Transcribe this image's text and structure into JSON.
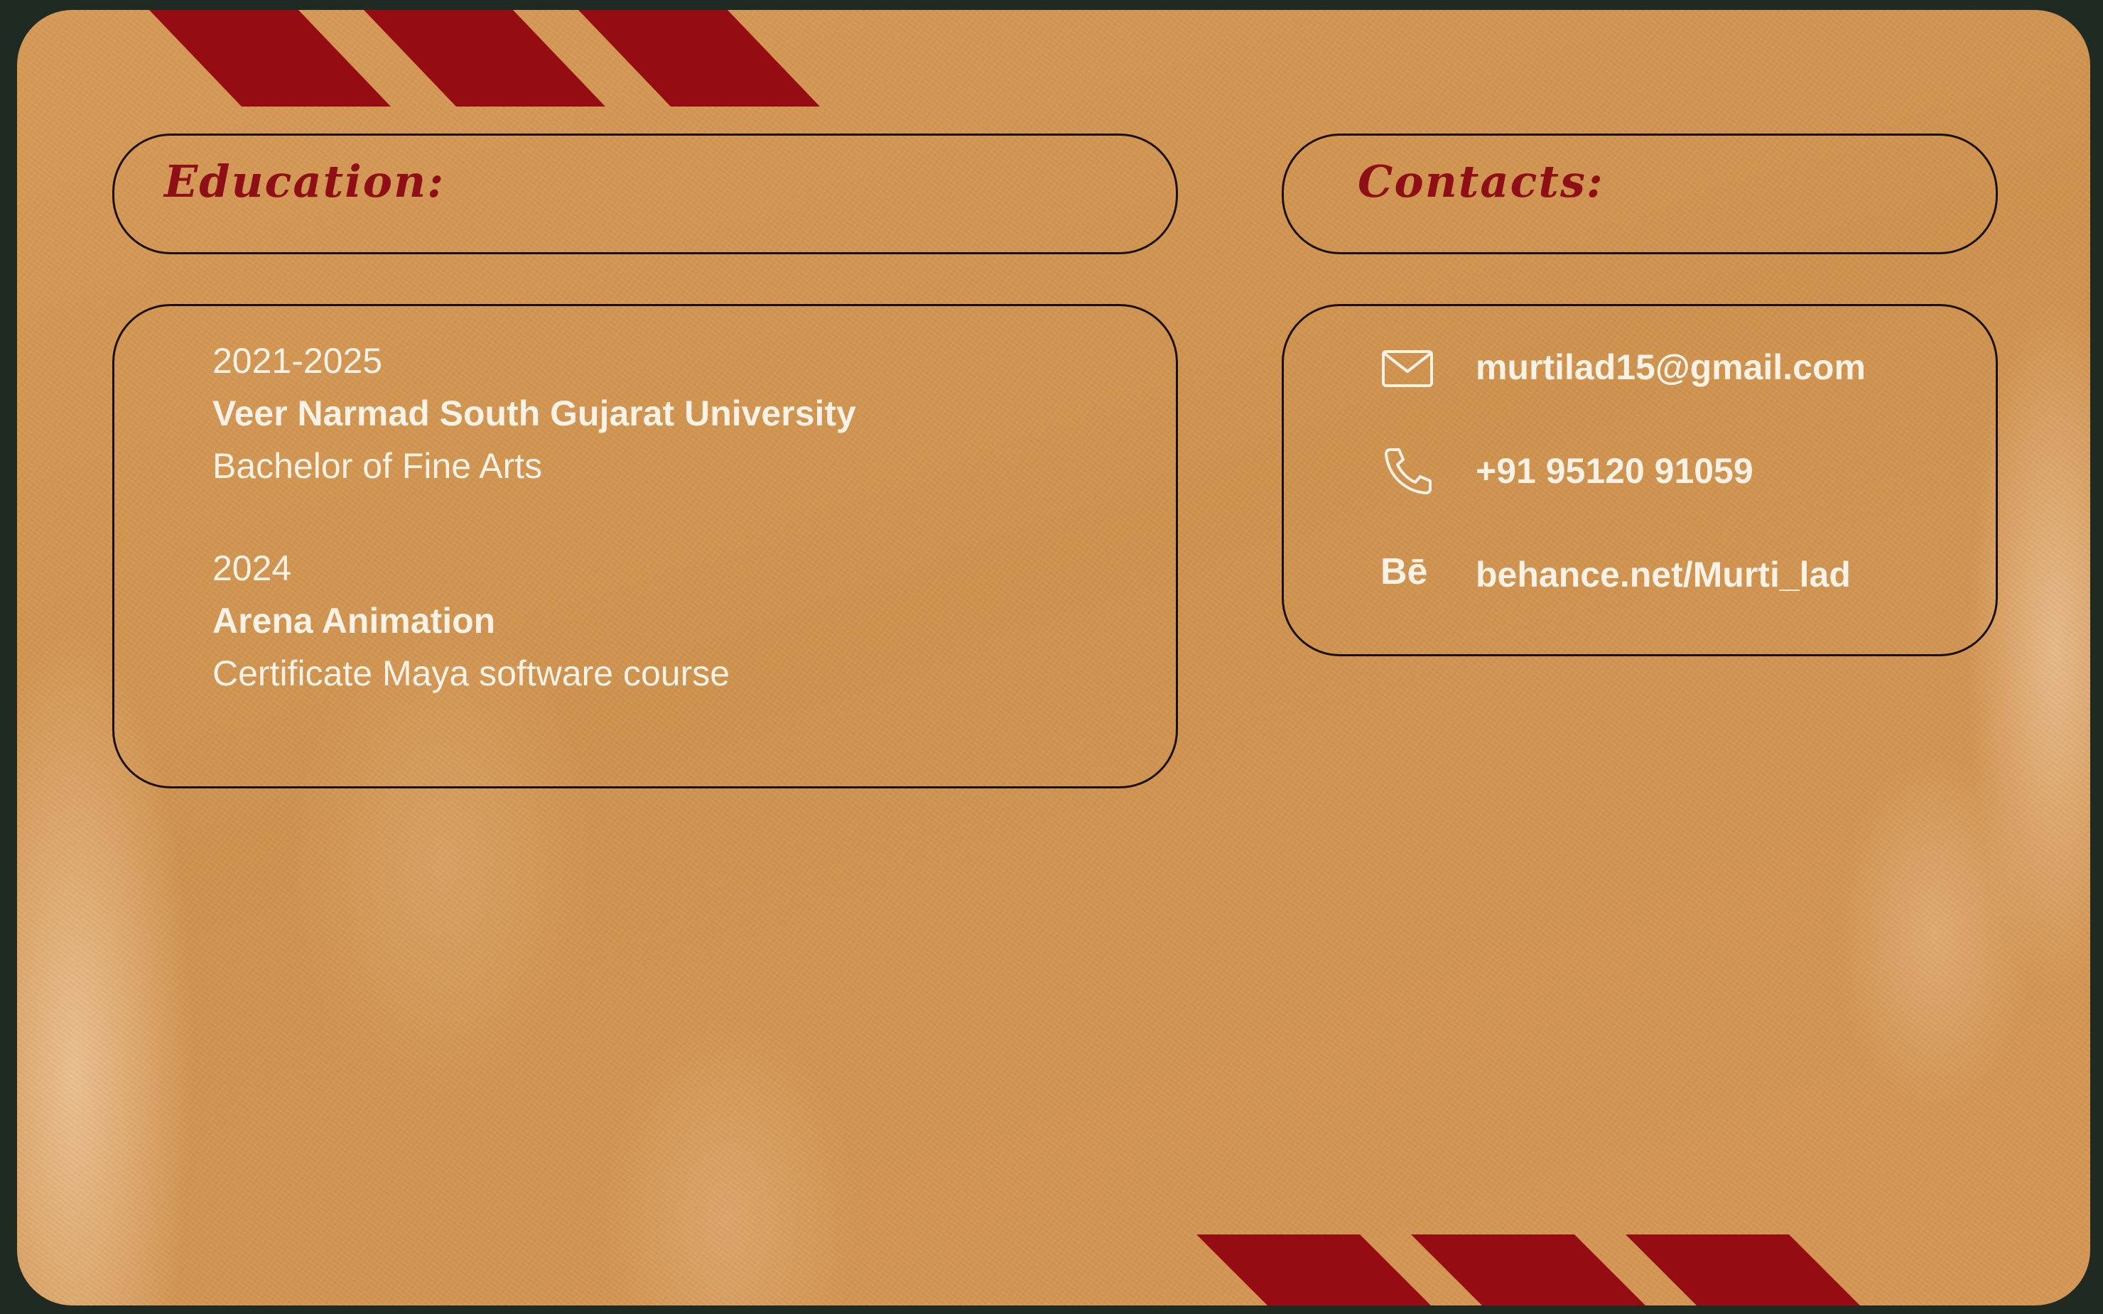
{
  "education": {
    "heading": "Education:",
    "entries": [
      {
        "years": "2021-2025",
        "institution": "Veer Narmad South Gujarat University",
        "program": "Bachelor of Fine Arts"
      },
      {
        "years": "2024",
        "institution": "Arena Animation",
        "program": "Certificate Maya software course"
      }
    ]
  },
  "contacts": {
    "heading": "Contacts:",
    "items": [
      {
        "icon": "mail-icon",
        "text": "murtilad15@gmail.com"
      },
      {
        "icon": "phone-icon",
        "text": "+91 95120 91059"
      },
      {
        "icon": "behance-icon",
        "glyph": "Bē",
        "text": "behance.net/Murti_lad"
      }
    ]
  },
  "colors": {
    "card": "#d69a58",
    "accent_red": "#950d12",
    "text_light": "#fbf1e4",
    "outline": "#1a1008"
  }
}
